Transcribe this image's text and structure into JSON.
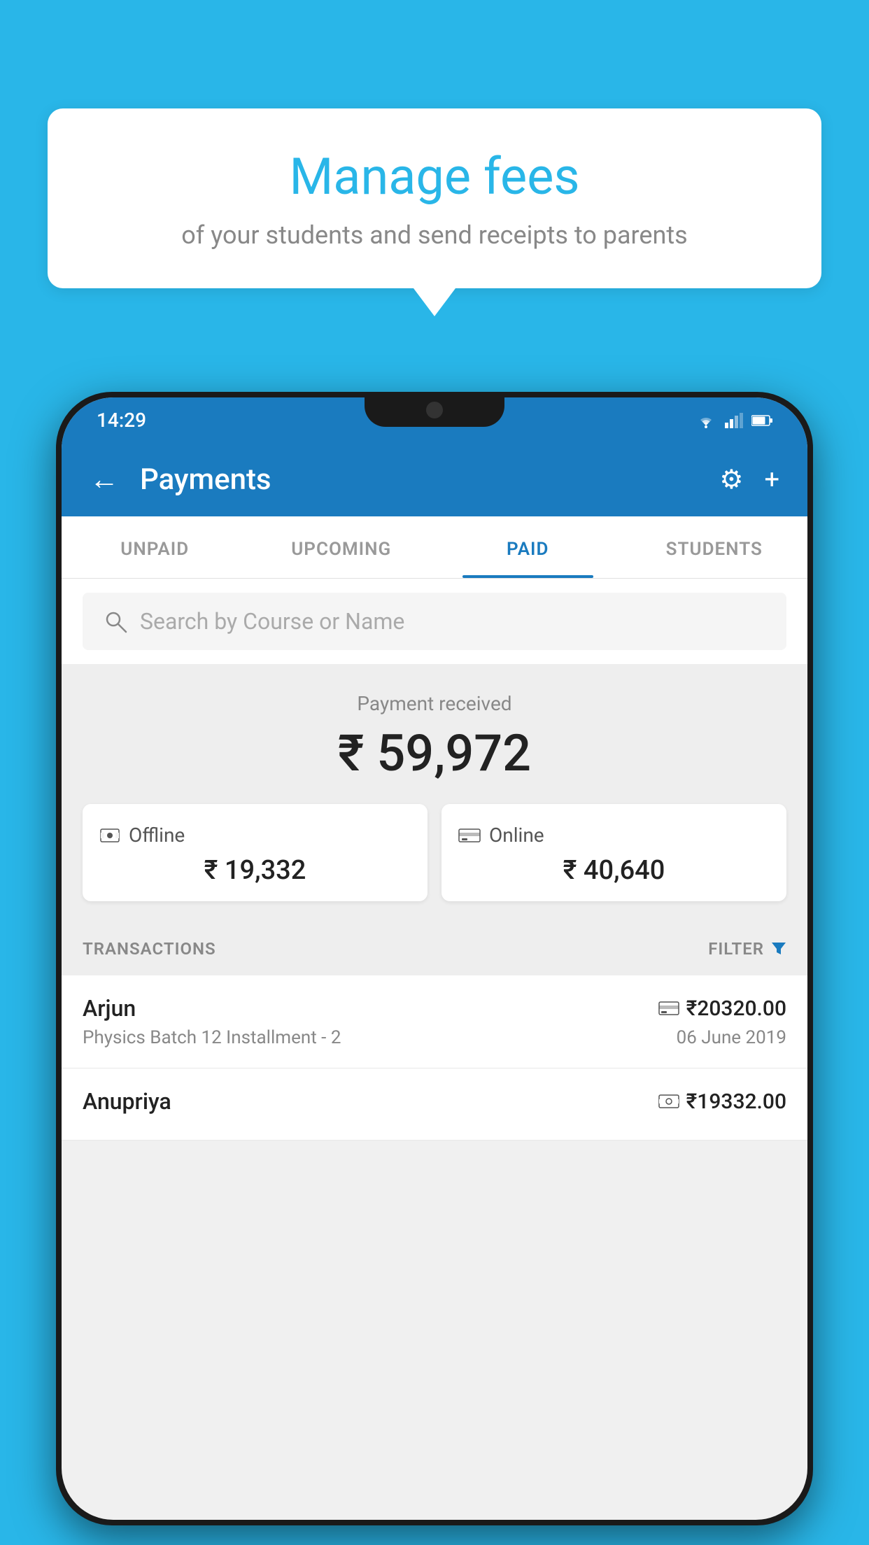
{
  "background_color": "#29b6e8",
  "bubble": {
    "title": "Manage fees",
    "subtitle": "of your students and send receipts to parents"
  },
  "status_bar": {
    "time": "14:29",
    "icons": [
      "wifi",
      "signal",
      "battery"
    ]
  },
  "app_bar": {
    "title": "Payments",
    "back_label": "←",
    "settings_label": "⚙",
    "add_label": "+"
  },
  "tabs": [
    {
      "label": "UNPAID",
      "active": false
    },
    {
      "label": "UPCOMING",
      "active": false
    },
    {
      "label": "PAID",
      "active": true
    },
    {
      "label": "STUDENTS",
      "active": false
    }
  ],
  "search": {
    "placeholder": "Search by Course or Name"
  },
  "payment": {
    "label": "Payment received",
    "amount": "₹ 59,972",
    "offline": {
      "type": "Offline",
      "amount": "₹ 19,332"
    },
    "online": {
      "type": "Online",
      "amount": "₹ 40,640"
    }
  },
  "transactions_label": "TRANSACTIONS",
  "filter_label": "FILTER",
  "transactions": [
    {
      "name": "Arjun",
      "amount": "₹20320.00",
      "payment_mode": "card",
      "course": "Physics Batch 12 Installment - 2",
      "date": "06 June 2019"
    },
    {
      "name": "Anupriya",
      "amount": "₹19332.00",
      "payment_mode": "offline",
      "course": "",
      "date": ""
    }
  ]
}
